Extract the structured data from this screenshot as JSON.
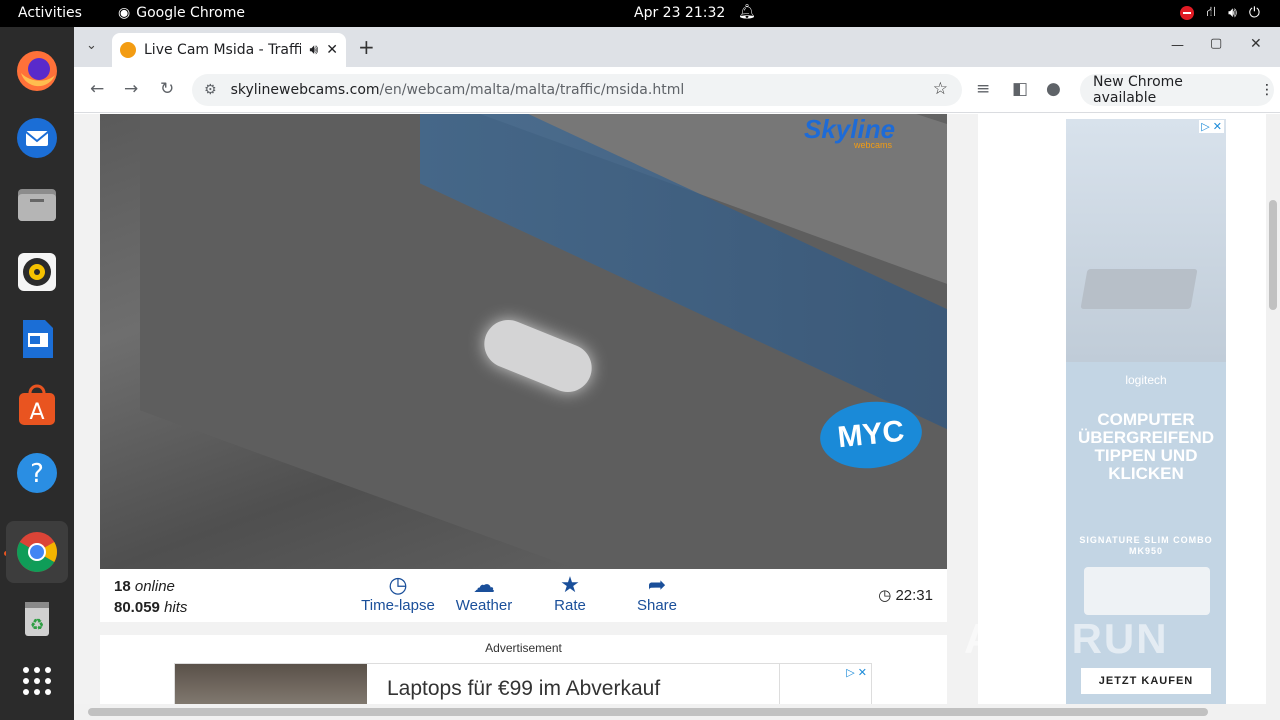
{
  "topbar": {
    "activities": "Activities",
    "app_name": "Google Chrome",
    "datetime": "Apr 23  21:32"
  },
  "dock": {
    "items": [
      {
        "name": "firefox",
        "icon": "firefox-icon"
      },
      {
        "name": "thunderbird",
        "icon": "thunderbird-icon"
      },
      {
        "name": "files",
        "icon": "files-icon"
      },
      {
        "name": "rhythmbox",
        "icon": "rhythmbox-icon"
      },
      {
        "name": "libreoffice-writer",
        "icon": "writer-icon"
      },
      {
        "name": "app-center",
        "icon": "app-center-icon"
      },
      {
        "name": "help",
        "icon": "help-icon"
      },
      {
        "name": "chrome",
        "icon": "chrome-icon",
        "active": true
      },
      {
        "name": "trash",
        "icon": "trash-icon"
      },
      {
        "name": "show-apps",
        "icon": "grid-icon"
      }
    ]
  },
  "browser": {
    "tab_title": "Live Cam Msida - Traffi",
    "url_domain": "skylinewebcams.com",
    "url_path": "/en/webcam/malta/malta/traffic/msida.html",
    "update_chip": "New Chrome available"
  },
  "webcam": {
    "logo_main": "Skyline",
    "logo_sub": "webcams",
    "overlay_logo": "MYC"
  },
  "stats": {
    "online_count": "18",
    "online_label": "online",
    "hits_count": "80.059",
    "hits_label": "hits",
    "time": "22:31"
  },
  "actions": [
    {
      "label": "Time-lapse",
      "icon": "timelapse-icon"
    },
    {
      "label": "Weather",
      "icon": "weather-icon"
    },
    {
      "label": "Rate",
      "icon": "star-icon"
    },
    {
      "label": "Share",
      "icon": "share-icon"
    }
  ],
  "ad": {
    "label": "Advertisement",
    "headline": "Laptops für €99 im Abverkauf"
  },
  "side_ad": {
    "brand": "logitech",
    "headline": "COMPUTER ÜBERGREIFEND TIPPEN UND KLICKEN",
    "product": "SIGNATURE SLIM COMBO MK950",
    "cta": "JETZT KAUFEN"
  },
  "watermark": "ANY RUN"
}
